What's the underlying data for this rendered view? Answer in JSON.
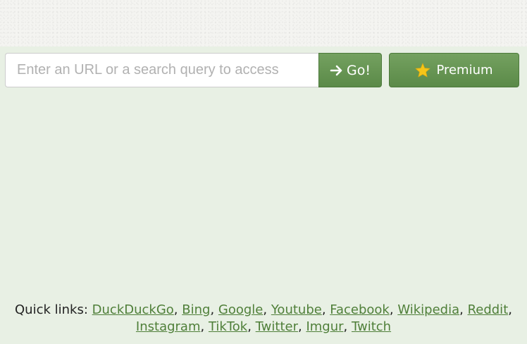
{
  "search": {
    "placeholder": "Enter an URL or a search query to access",
    "value": "",
    "go_label": "Go!"
  },
  "premium": {
    "label": "Premium"
  },
  "quick_links": {
    "label": "Quick links:",
    "row1": [
      "DuckDuckGo",
      "Bing",
      "Google",
      "Youtube",
      "Facebook",
      "Wikipedia",
      "Reddit"
    ],
    "row2": [
      "Instagram",
      "TikTok",
      "Twitter",
      "Imgur",
      "Twitch"
    ]
  },
  "icons": {
    "go": "arrow-right-icon",
    "premium": "star-icon"
  },
  "colors": {
    "page_background": "#e8f0e4",
    "top_band": "#f4f4f1",
    "button_green": "#6a9757",
    "link_green": "#4f7f39",
    "star_gold": "#f5c518"
  }
}
